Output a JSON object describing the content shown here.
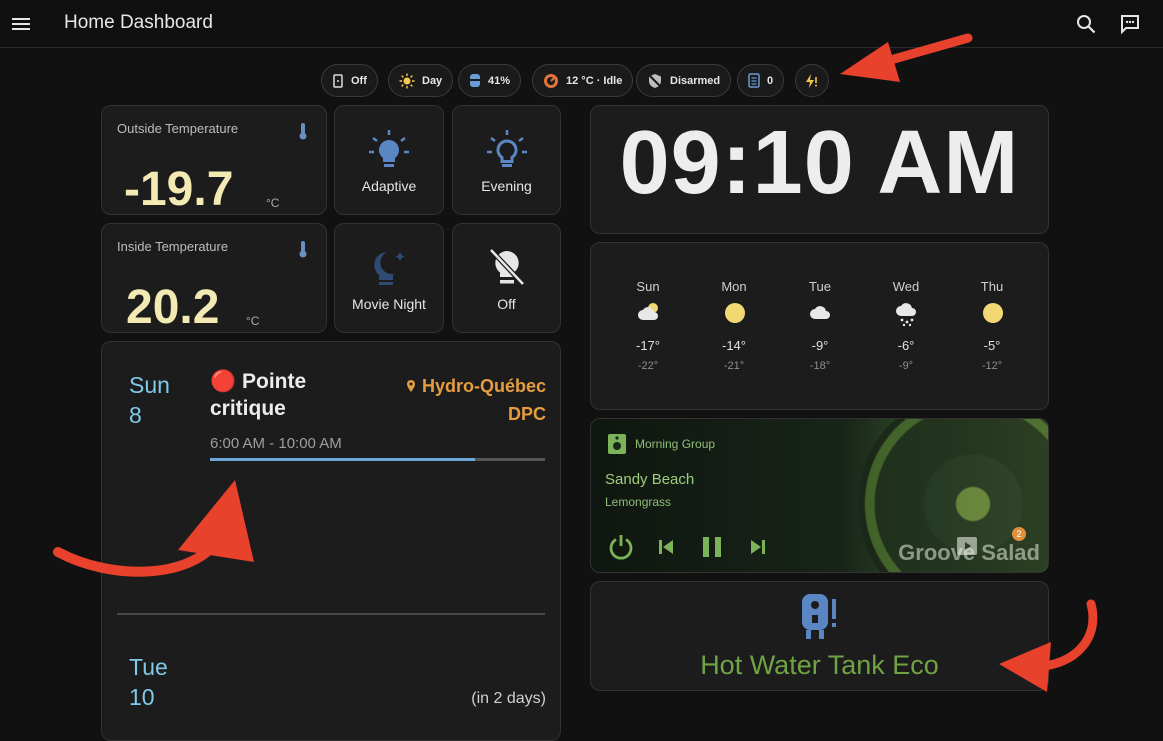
{
  "header": {
    "title": "Home Dashboard"
  },
  "chips": [
    {
      "icon": "door-icon",
      "label": "Off"
    },
    {
      "icon": "sun-icon",
      "label": "Day"
    },
    {
      "icon": "water-tank-icon",
      "label": "41%"
    },
    {
      "icon": "thermostat-icon",
      "label": "12 °C · Idle"
    },
    {
      "icon": "shield-off-icon",
      "label": "Disarmed"
    },
    {
      "icon": "notes-icon",
      "label": "0"
    },
    {
      "icon": "flash-alert-icon",
      "label": ""
    }
  ],
  "outside": {
    "name": "Outside Temperature",
    "value": "-19.7",
    "unit": "°C"
  },
  "inside": {
    "name": "Inside Temperature",
    "value": "20.2",
    "unit": "°C"
  },
  "scenes": [
    {
      "label": "Adaptive",
      "icon": "lightbulb-on-icon"
    },
    {
      "label": "Evening",
      "icon": "lightbulb-outline-icon"
    },
    {
      "label": "Movie Night",
      "icon": "lightbulb-night-icon"
    },
    {
      "label": "Off",
      "icon": "lightbulb-off-icon"
    }
  ],
  "calendar": {
    "day1": {
      "weekday": "Sun",
      "day": "8"
    },
    "event_title": "🔴 Pointe critique",
    "event_location_line1": "Hydro-Québec",
    "event_location_line2": "DPC",
    "event_time": "6:00 AM - 10:00 AM",
    "event_progress": 0.79,
    "day2": {
      "weekday": "Tue",
      "day": "10"
    },
    "day2_relative": "(in 2 days)"
  },
  "clock": {
    "time": "09:10 AM"
  },
  "forecast": [
    {
      "day": "Sun",
      "icon": "partly-cloudy-icon",
      "high": "-17°",
      "low": "-22°"
    },
    {
      "day": "Mon",
      "icon": "sunny-icon",
      "high": "-14°",
      "low": "-21°"
    },
    {
      "day": "Tue",
      "icon": "cloudy-icon",
      "high": "-9°",
      "low": "-18°"
    },
    {
      "day": "Wed",
      "icon": "snowy-icon",
      "high": "-6°",
      "low": "-9°"
    },
    {
      "day": "Thu",
      "icon": "sunny-icon",
      "high": "-5°",
      "low": "-12°"
    }
  ],
  "media": {
    "group": "Morning Group",
    "title": "Sandy Beach",
    "artist": "Lemongrass",
    "station": "Groove Salad",
    "badge": "2"
  },
  "water_heater": {
    "label": "Hot Water Tank Eco"
  },
  "colors": {
    "accent_green": "#6fa343",
    "calendar_blue": "#7fc9e9",
    "location_orange": "#e59d3f",
    "temp_yellow": "#f3e9b3",
    "annotation_red": "#e8412c"
  }
}
